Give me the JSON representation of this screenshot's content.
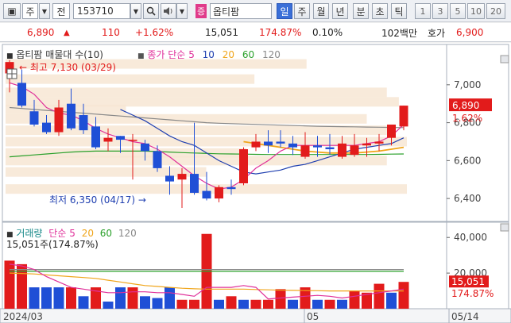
{
  "toolbar": {
    "icon_label": "▣",
    "market_type": "주",
    "jeon": "전",
    "stock_code": "153710",
    "stock_badge": "증",
    "stock_name": "옵티팜",
    "periods": [
      "일",
      "주",
      "월",
      "년",
      "분",
      "초",
      "틱"
    ],
    "active_period": "일",
    "intervals": [
      "1",
      "3",
      "5",
      "10",
      "20"
    ]
  },
  "price_row": {
    "price": "6,890",
    "change": "110",
    "change_pct": "+1.62%",
    "volume": "15,051",
    "volume_ratio": "174.87%",
    "turnover_pct": "0.10%",
    "amount": "102백만",
    "quote_label": "호가",
    "quote_price": "6,900"
  },
  "price_panel": {
    "title": "옵티팜 매물대 수(10)",
    "legend": {
      "close": "종가",
      "simple": "단순",
      "ma": [
        "5",
        "10",
        "20",
        "60",
        "120"
      ]
    },
    "high_label": "최고 7,130 (03/29)",
    "low_label": "최저 6,350 (04/17)",
    "current_price_tag": "6,890",
    "current_pct_tag": "1.62%",
    "y_ticks": [
      "7,000",
      "6,800",
      "6,600",
      "6,400"
    ]
  },
  "volume_panel": {
    "title": "거래량",
    "legend": {
      "simple": "단순",
      "ma": [
        "5",
        "20",
        "60",
        "120"
      ]
    },
    "current_label": "15,051주(174.87%)",
    "current_tag": "15,051",
    "current_pct_tag": "174.87%",
    "y_ticks": [
      "40,000",
      "20,000"
    ]
  },
  "x_labels": [
    "2024/03",
    "05",
    "05/14"
  ],
  "colors": {
    "up": "#e21b1b",
    "down": "#1f4fd6",
    "ma5": "#e0309a",
    "ma10": "#1f3fb0",
    "ma20": "#f0a51a",
    "ma60": "#2aa02a",
    "ma120": "#888888",
    "volume_profile": "#f7e6d4"
  },
  "chart_data": {
    "type": "candlestick",
    "price": {
      "ylim": [
        6300,
        7150
      ],
      "candles": [
        {
          "o": 7060,
          "h": 7130,
          "l": 6960,
          "c": 7120
        },
        {
          "o": 7010,
          "h": 7080,
          "l": 6880,
          "c": 6890
        },
        {
          "o": 6860,
          "h": 6920,
          "l": 6780,
          "c": 6790
        },
        {
          "o": 6800,
          "h": 6840,
          "l": 6740,
          "c": 6750
        },
        {
          "o": 6750,
          "h": 6920,
          "l": 6730,
          "c": 6880
        },
        {
          "o": 6900,
          "h": 6980,
          "l": 6760,
          "c": 6770
        },
        {
          "o": 6840,
          "h": 6900,
          "l": 6740,
          "c": 6760
        },
        {
          "o": 6780,
          "h": 6830,
          "l": 6660,
          "c": 6670
        },
        {
          "o": 6700,
          "h": 6770,
          "l": 6650,
          "c": 6720
        },
        {
          "o": 6730,
          "h": 6730,
          "l": 6640,
          "c": 6710
        },
        {
          "o": 6710,
          "h": 6740,
          "l": 6500,
          "c": 6710
        },
        {
          "o": 6690,
          "h": 6710,
          "l": 6600,
          "c": 6650
        },
        {
          "o": 6650,
          "h": 6680,
          "l": 6540,
          "c": 6560
        },
        {
          "o": 6520,
          "h": 6570,
          "l": 6420,
          "c": 6490
        },
        {
          "o": 6500,
          "h": 6560,
          "l": 6350,
          "c": 6530
        },
        {
          "o": 6530,
          "h": 6800,
          "l": 6420,
          "c": 6430
        },
        {
          "o": 6440,
          "h": 6540,
          "l": 6390,
          "c": 6400
        },
        {
          "o": 6400,
          "h": 6470,
          "l": 6380,
          "c": 6460
        },
        {
          "o": 6460,
          "h": 6500,
          "l": 6420,
          "c": 6450
        },
        {
          "o": 6480,
          "h": 6670,
          "l": 6470,
          "c": 6660
        },
        {
          "o": 6670,
          "h": 6740,
          "l": 6650,
          "c": 6700
        },
        {
          "o": 6700,
          "h": 6760,
          "l": 6640,
          "c": 6680
        },
        {
          "o": 6700,
          "h": 6760,
          "l": 6670,
          "c": 6690
        },
        {
          "o": 6690,
          "h": 6730,
          "l": 6630,
          "c": 6670
        },
        {
          "o": 6620,
          "h": 6750,
          "l": 6610,
          "c": 6680
        },
        {
          "o": 6680,
          "h": 6730,
          "l": 6620,
          "c": 6670
        },
        {
          "o": 6670,
          "h": 6740,
          "l": 6630,
          "c": 6660
        },
        {
          "o": 6620,
          "h": 6730,
          "l": 6610,
          "c": 6690
        },
        {
          "o": 6630,
          "h": 6740,
          "l": 6620,
          "c": 6680
        },
        {
          "o": 6680,
          "h": 6720,
          "l": 6620,
          "c": 6690
        },
        {
          "o": 6690,
          "h": 6740,
          "l": 6650,
          "c": 6700
        },
        {
          "o": 6720,
          "h": 6790,
          "l": 6680,
          "c": 6790
        },
        {
          "o": 6780,
          "h": 6890,
          "l": 6760,
          "c": 6890
        }
      ],
      "ma5": [
        7010,
        6990,
        6950,
        6880,
        6850,
        6840,
        6810,
        6770,
        6740,
        6720,
        6700,
        6690,
        6660,
        6620,
        6570,
        6520,
        6480,
        6450,
        6460,
        6500,
        6560,
        6600,
        6650,
        6680,
        6680,
        6680,
        6680,
        6680,
        6680,
        6690,
        6700,
        6730,
        6790
      ],
      "ma10": [
        null,
        null,
        null,
        null,
        null,
        null,
        null,
        null,
        null,
        6870,
        6840,
        6810,
        6770,
        6730,
        6700,
        6680,
        6640,
        6600,
        6570,
        6540,
        6530,
        6540,
        6550,
        6570,
        6580,
        6600,
        6620,
        6640,
        6660,
        6670,
        6680,
        6690,
        6720
      ],
      "ma20": [
        null,
        null,
        null,
        null,
        null,
        null,
        null,
        null,
        null,
        null,
        null,
        null,
        null,
        null,
        null,
        null,
        null,
        null,
        null,
        6700,
        6690,
        6680,
        6670,
        6660,
        6650,
        6645,
        6640,
        6640,
        6640,
        6645,
        6650,
        6660,
        6670
      ],
      "ma60": [
        6620,
        6625,
        6630,
        6635,
        6640,
        6645,
        6648,
        6650,
        6650,
        6650,
        6650,
        6650,
        6648,
        6645,
        6642,
        6640,
        6638,
        6636,
        6635,
        6634,
        6633,
        6632,
        6632,
        6632,
        6632,
        6632,
        6632,
        6632,
        6632,
        6632,
        6633,
        6634,
        6635
      ],
      "ma120": [
        6880,
        6875,
        6870,
        6865,
        6860,
        6855,
        6850,
        6845,
        6840,
        6835,
        6830,
        6825,
        6820,
        6815,
        6810,
        6805,
        6800,
        6797,
        6795,
        6793,
        6791,
        6789,
        6787,
        6785,
        6783,
        6781,
        6780,
        6779,
        6778,
        6777,
        6776,
        6775,
        6774
      ],
      "volume_profile": [
        {
          "price": 7110,
          "weight": 0.75
        },
        {
          "price": 7030,
          "weight": 0.62
        },
        {
          "price": 6960,
          "weight": 0.95
        },
        {
          "price": 6910,
          "weight": 0.98
        },
        {
          "price": 6870,
          "weight": 0.3
        },
        {
          "price": 6820,
          "weight": 0.9
        },
        {
          "price": 6760,
          "weight": 0.95
        },
        {
          "price": 6700,
          "weight": 1.0
        },
        {
          "price": 6640,
          "weight": 0.6
        },
        {
          "price": 6600,
          "weight": 0.95
        },
        {
          "price": 6540,
          "weight": 0.5
        },
        {
          "price": 6450,
          "weight": 1.0
        }
      ]
    },
    "volume": {
      "ylim": [
        0,
        45000
      ],
      "values": [
        27000,
        25000,
        12000,
        12000,
        12000,
        12000,
        7000,
        12000,
        4000,
        12000,
        12000,
        7000,
        6000,
        12000,
        5000,
        5000,
        42000,
        5000,
        7000,
        5000,
        5000,
        5000,
        11000,
        5000,
        12000,
        5000,
        5000,
        5000,
        10000,
        9000,
        14000,
        9000,
        15051
      ],
      "up": [
        true,
        true,
        false,
        false,
        false,
        true,
        false,
        true,
        false,
        false,
        true,
        false,
        false,
        false,
        true,
        true,
        true,
        false,
        true,
        false,
        true,
        true,
        true,
        false,
        true,
        false,
        true,
        false,
        true,
        true,
        true,
        false,
        true
      ],
      "ma5": [
        25000,
        24000,
        22000,
        18000,
        15000,
        12000,
        11000,
        10000,
        9000,
        9000,
        9500,
        9500,
        9000,
        9000,
        8000,
        7000,
        12000,
        12000,
        12000,
        13000,
        12000,
        5500,
        6000,
        6500,
        7000,
        7500,
        7000,
        6000,
        7000,
        8000,
        9000,
        10000,
        11000
      ],
      "ma20": [
        20000,
        19800,
        19500,
        19000,
        18500,
        18000,
        17500,
        17000,
        16000,
        15000,
        14000,
        13000,
        12500,
        12000,
        11500,
        11200,
        11000,
        11000,
        11000,
        11000,
        10800,
        10600,
        10400,
        10300,
        10200,
        10100,
        10000,
        10000,
        10000,
        10000,
        10000,
        10000,
        10000
      ],
      "ma60": [
        21000,
        21000,
        21000,
        21000,
        21000,
        21000,
        21000,
        21000,
        21000,
        21000,
        21000,
        21000,
        21000,
        21000,
        21000,
        21000,
        21000,
        21000,
        21000,
        21000,
        21000,
        21000,
        21000,
        21000,
        21000,
        21000,
        21000,
        21000,
        21000,
        21000,
        21000,
        21000,
        21000
      ],
      "ma120": [
        22000,
        22000,
        22000,
        22000,
        22000,
        22000,
        22000,
        22000,
        22000,
        22000,
        22000,
        22000,
        22000,
        22000,
        22000,
        22000,
        22000,
        22000,
        22000,
        22000,
        22000,
        22000,
        22000,
        22000,
        22000,
        22000,
        22000,
        22000,
        22000,
        22000,
        22000,
        22000,
        22000
      ]
    }
  }
}
